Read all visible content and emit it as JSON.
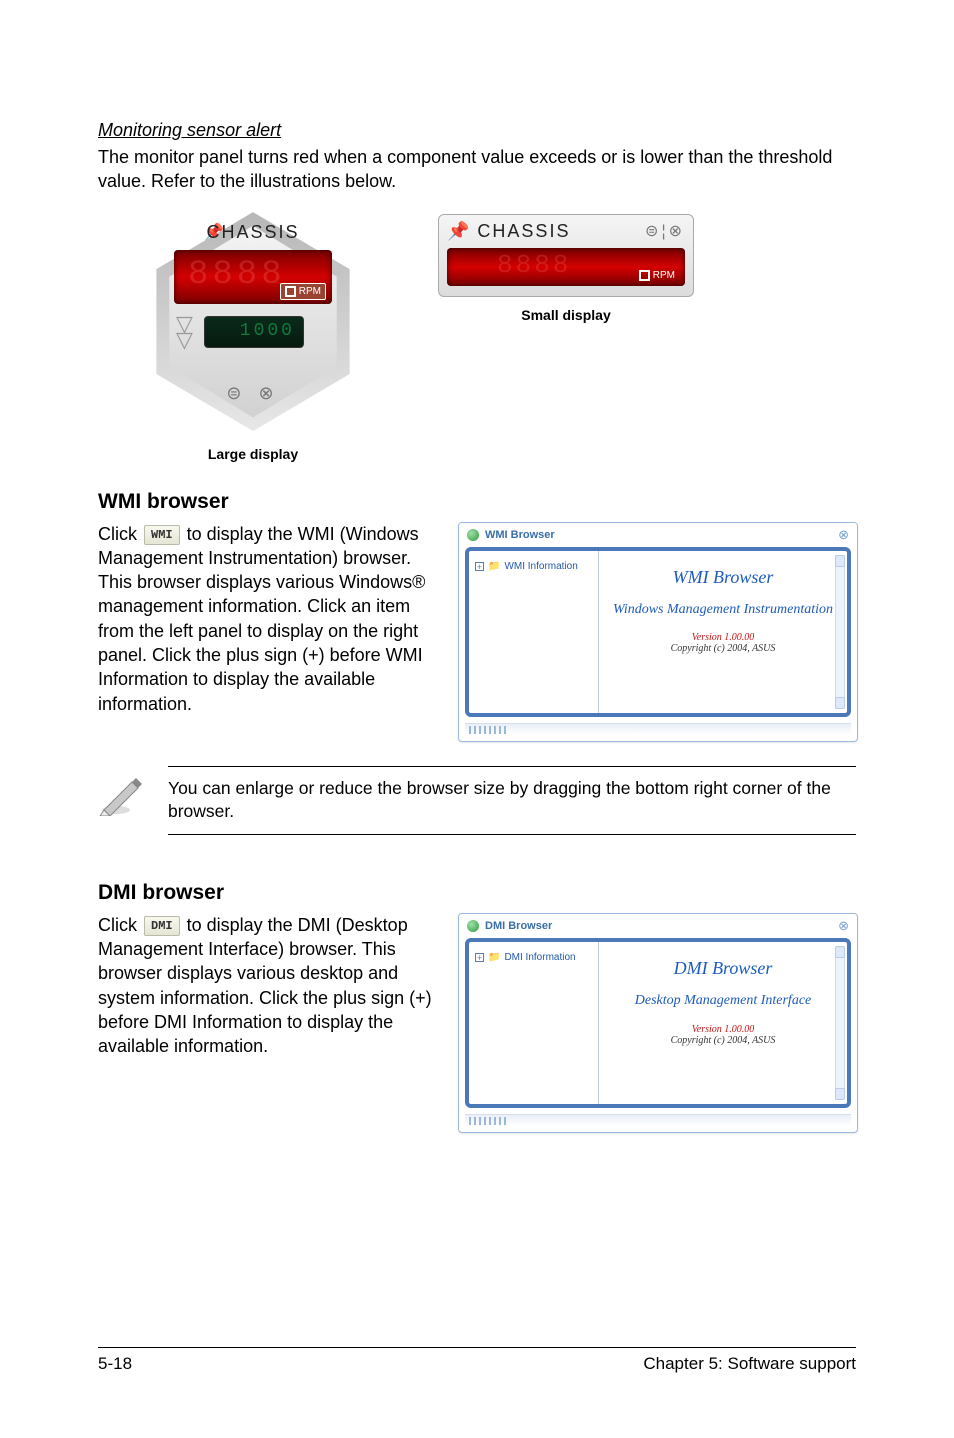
{
  "section1": {
    "heading": "Monitoring sensor alert",
    "paragraph": "The monitor panel turns red when a component value exceeds or is lower than the threshold value. Refer to the illustrations below."
  },
  "displays": {
    "chassis_label": "CHASSIS",
    "rpm_label": "RPM",
    "threshold_digits": "1000",
    "large_caption": "Large display",
    "small_caption": "Small display"
  },
  "wmi": {
    "heading": "WMI browser",
    "btn": "WMI",
    "para_before": "Click ",
    "para_after": " to display the WMI (Windows Management Instrumentation) browser. This browser displays various Windows® management information. Click an item from the left panel to display on the right panel. Click the plus sign (+) before WMI Information to display the available information.",
    "window": {
      "titlebar": "WMI Browser",
      "tree_item": "WMI Information",
      "title": "WMI Browser",
      "sub": "Windows Management Instrumentation",
      "version": "Version 1.00.00",
      "copyright": "Copyright (c) 2004, ASUS"
    }
  },
  "note": {
    "text": "You can enlarge or reduce the browser size by dragging the bottom right corner of the browser."
  },
  "dmi": {
    "heading": "DMI browser",
    "btn": "DMI",
    "para_before": "Click ",
    "para_after": " to display the DMI (Desktop Management Interface) browser. This browser displays various desktop and system information. Click the plus sign (+) before DMI Information to display the available information.",
    "window": {
      "titlebar": "DMI Browser",
      "tree_item": "DMI Information",
      "title": "DMI Browser",
      "sub": "Desktop Management Interface",
      "version": "Version 1.00.00",
      "copyright": "Copyright (c) 2004, ASUS"
    }
  },
  "footer": {
    "left": "5-18",
    "right": "Chapter 5: Software support"
  }
}
